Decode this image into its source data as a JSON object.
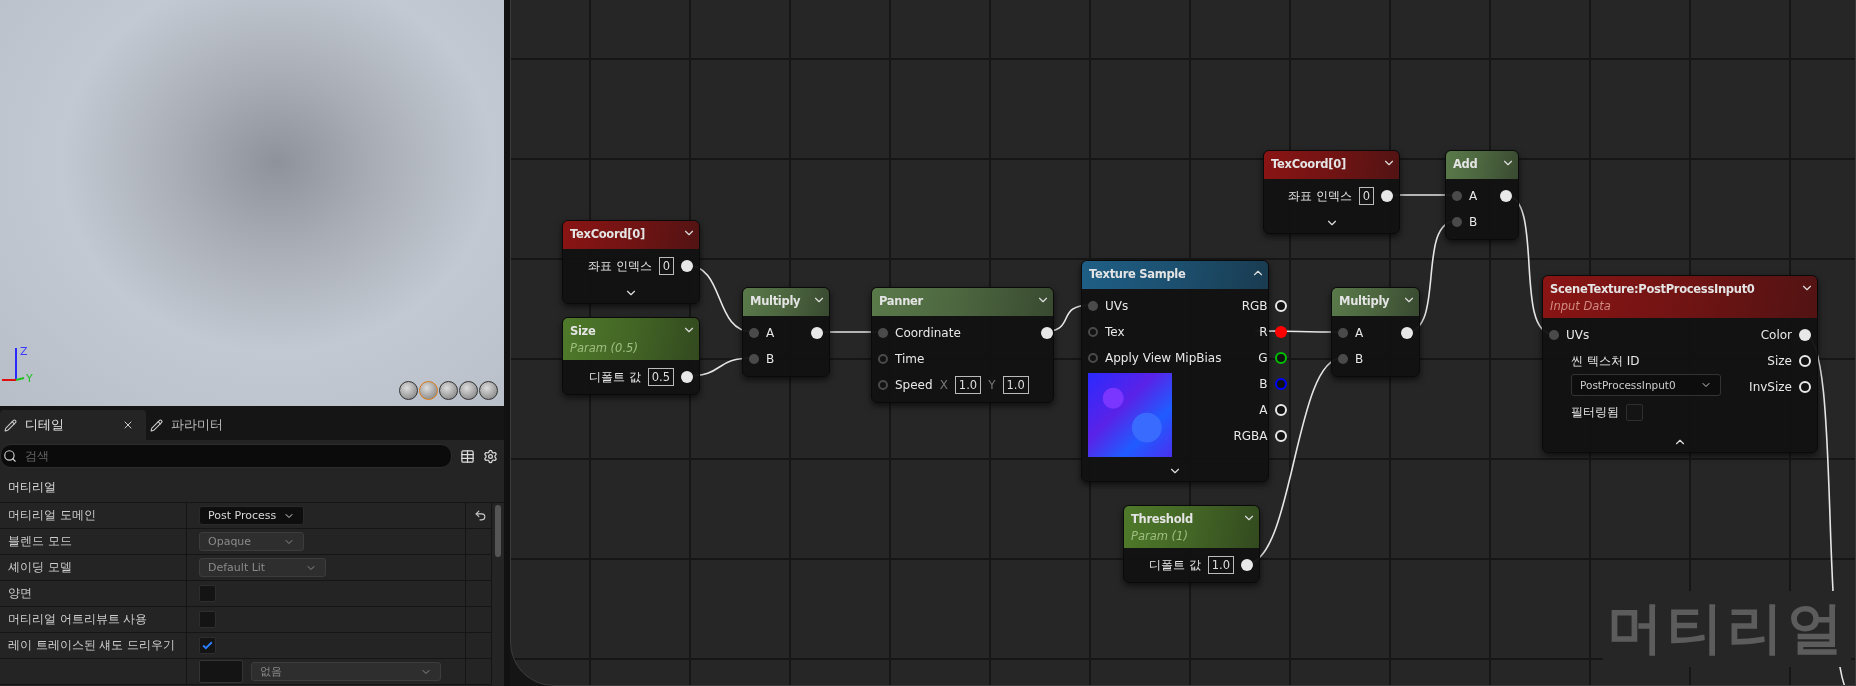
{
  "viewport": {
    "axis_labels": [
      "Z",
      "Y"
    ]
  },
  "details_panel": {
    "tabs": [
      {
        "label": "디테일",
        "selected": true
      },
      {
        "label": "파라미터",
        "selected": false
      }
    ],
    "search": {
      "placeholder": "검색"
    },
    "section": "머티리얼",
    "properties": [
      {
        "kind": "dropdown",
        "label": "머티리얼 도메인",
        "value": "Post Process",
        "disabled": false,
        "modified": true
      },
      {
        "kind": "dropdown",
        "label": "블렌드 모드",
        "value": "Opaque",
        "disabled": true,
        "modified": false
      },
      {
        "kind": "dropdown",
        "label": "셰이딩 모델",
        "value": "Default Lit",
        "disabled": true,
        "modified": false
      },
      {
        "kind": "checkbox",
        "label": "양면",
        "checked": false
      },
      {
        "kind": "checkbox",
        "label": "머티리얼 어트리뷰트 사용",
        "checked": false
      },
      {
        "kind": "checkbox",
        "label": "레이 트레이스된 섀도 드리우기",
        "checked": true
      },
      {
        "kind": "texture",
        "value": "없음"
      }
    ]
  },
  "graph": {
    "corner_label": "머티리얼",
    "nodes": [
      {
        "kind": "constant",
        "title": "TexCoord[0]",
        "color": "#8a1414",
        "outputs": [
          {
            "kind": "value",
            "label": "좌표 인덱스",
            "value": "0",
            "connected": true
          }
        ],
        "footer_expanded": false
      },
      {
        "kind": "parameter",
        "title": "Size",
        "subtitle": "Param (0.5)",
        "color": "#4f7a2a",
        "outputs": [
          {
            "kind": "value",
            "label": "디폴트 값",
            "value": "0.5",
            "connected": true
          }
        ]
      },
      {
        "kind": "math",
        "title": "Multiply",
        "color": "#5a7a4a",
        "inputs": [
          {
            "kind": "pin",
            "label": "A",
            "connected": true
          },
          {
            "kind": "pin",
            "label": "B",
            "connected": true
          }
        ],
        "outputs": [
          {
            "kind": "pin",
            "connected": true
          }
        ]
      },
      {
        "kind": "math",
        "title": "Panner",
        "color": "#5a7a4a",
        "inputs": [
          {
            "kind": "pin",
            "label": "Coordinate",
            "connected": true
          },
          {
            "kind": "pin",
            "label": "Time",
            "connected": false
          },
          {
            "kind": "pin",
            "label": "Speed",
            "connected": false,
            "fields": [
              {
                "axis": "X",
                "value": "1.0"
              },
              {
                "axis": "Y",
                "value": "1.0"
              }
            ]
          }
        ],
        "outputs": [
          {
            "kind": "pin",
            "connected": true
          }
        ]
      },
      {
        "kind": "texture",
        "title": "Texture Sample",
        "color": "#1f5f86",
        "inputs": [
          {
            "kind": "pin",
            "label": "UVs",
            "connected": true
          },
          {
            "kind": "pin",
            "label": "Tex",
            "connected": false
          },
          {
            "kind": "pin",
            "label": "Apply View MipBias",
            "connected": false
          },
          {
            "kind": "preview"
          }
        ],
        "outputs": [
          {
            "kind": "pin",
            "label": "RGB",
            "connected": false
          },
          {
            "kind": "pin",
            "label": "R",
            "connected": true,
            "color": "#ff0000"
          },
          {
            "kind": "pin",
            "label": "G",
            "connected": false,
            "color": "#00c000"
          },
          {
            "kind": "pin",
            "label": "B",
            "connected": false,
            "color": "#0000ff"
          },
          {
            "kind": "pin",
            "label": "A",
            "connected": false
          },
          {
            "kind": "pin",
            "label": "RGBA",
            "connected": false
          }
        ],
        "footer_expanded": false
      },
      {
        "kind": "parameter",
        "title": "Threshold",
        "subtitle": "Param (1)",
        "color": "#4f7a2a",
        "outputs": [
          {
            "kind": "value",
            "label": "디폴트 값",
            "value": "1.0",
            "connected": true
          }
        ]
      },
      {
        "kind": "constant",
        "title": "TexCoord[0]",
        "color": "#8a1414",
        "outputs": [
          {
            "kind": "value",
            "label": "좌표 인덱스",
            "value": "0",
            "connected": true
          }
        ],
        "footer_expanded": false
      },
      {
        "kind": "math",
        "title": "Multiply",
        "color": "#5a7a4a",
        "inputs": [
          {
            "kind": "pin",
            "label": "A",
            "connected": true
          },
          {
            "kind": "pin",
            "label": "B",
            "connected": true
          }
        ],
        "outputs": [
          {
            "kind": "pin",
            "connected": true
          }
        ]
      },
      {
        "kind": "math",
        "title": "Add",
        "color": "#5a7a4a",
        "inputs": [
          {
            "kind": "pin",
            "label": "A",
            "connected": true
          },
          {
            "kind": "pin",
            "label": "B",
            "connected": true
          }
        ],
        "outputs": [
          {
            "kind": "pin",
            "connected": true
          }
        ]
      },
      {
        "kind": "scene",
        "title": "SceneTexture:PostProcessInput0",
        "subtitle": "Input Data",
        "color": "#8a1414",
        "inputs": [
          {
            "kind": "pin",
            "label": "UVs",
            "connected": true
          },
          {
            "kind": "dropdown",
            "label": "씬 텍스처 ID",
            "value": "PostProcessInput0"
          },
          {
            "kind": "checkbox",
            "label": "필터링됨",
            "checked": false
          }
        ],
        "outputs": [
          {
            "kind": "pin",
            "label": "Color",
            "connected": true
          },
          {
            "kind": "pin",
            "label": "Size",
            "connected": false
          },
          {
            "kind": "pin",
            "label": "InvSize",
            "connected": false
          }
        ],
        "footer_expanded": true
      }
    ]
  }
}
